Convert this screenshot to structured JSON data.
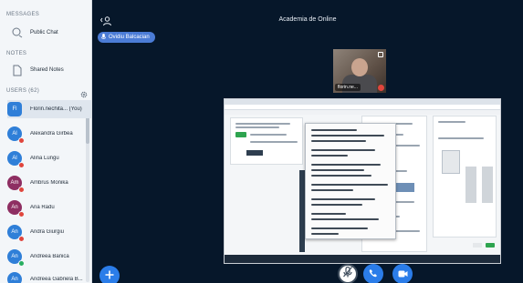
{
  "sidebar": {
    "messages_title": "MESSAGES",
    "public_chat_label": "Public Chat",
    "notes_title": "NOTES",
    "shared_notes_label": "Shared Notes",
    "users_title": "USERS (62)",
    "users": [
      {
        "initials": "Fl",
        "name": "Florin.nechita... (You)",
        "color": "#2f7fd8",
        "shape": "square",
        "mic": "none"
      },
      {
        "initials": "Al",
        "name": "Alexandra Girbea",
        "color": "#2f7fd8",
        "shape": "round",
        "mic": "muted"
      },
      {
        "initials": "Al",
        "name": "Alina Lungu",
        "color": "#2f7fd8",
        "shape": "round",
        "mic": "muted"
      },
      {
        "initials": "Am",
        "name": "Ambrus Monika",
        "color": "#8e2e62",
        "shape": "round",
        "mic": "muted"
      },
      {
        "initials": "An",
        "name": "Ana Radu",
        "color": "#8e2e62",
        "shape": "round",
        "mic": "muted"
      },
      {
        "initials": "An",
        "name": "Andra Giurgiu",
        "color": "#2f7fd8",
        "shape": "round",
        "mic": "muted"
      },
      {
        "initials": "An",
        "name": "Andreea Bănică",
        "color": "#2f7fd8",
        "shape": "round",
        "mic": "listen"
      },
      {
        "initials": "An",
        "name": "Andreea Gabriela B...",
        "color": "#2f7fd8",
        "shape": "round",
        "mic": "muted"
      }
    ]
  },
  "main": {
    "meeting_title": "Academia de Online",
    "presenter_name": "Ovidiu Balcacian",
    "webcam_name": "florin.ne..."
  },
  "icons": {
    "chat": "chat-bubbles-icon",
    "notes": "document-icon",
    "settings": "gear-icon",
    "user_list_toggle": "users-icon",
    "add": "plus-icon",
    "mic": "mic-muted-icon",
    "phone": "phone-icon",
    "camera": "video-camera-icon"
  },
  "colors": {
    "background": "#06172a",
    "accent": "#2b7de9",
    "muted": "#e0453c",
    "listen": "#27ae60",
    "sidebar": "#f3f6f9"
  }
}
